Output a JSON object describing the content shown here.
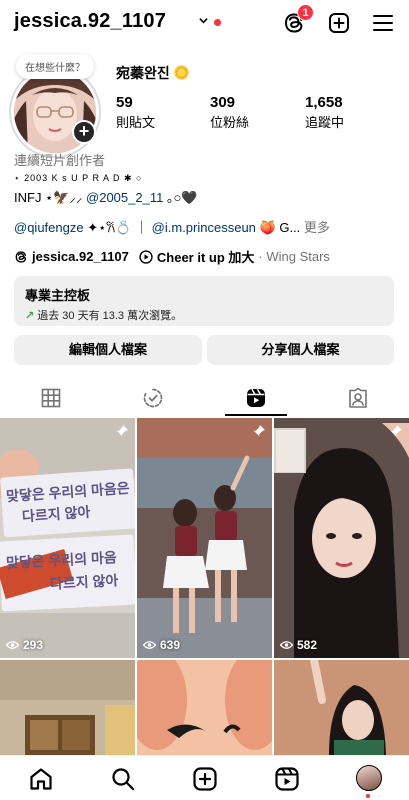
{
  "header": {
    "username": "jessica.92_1107",
    "notification_count": "1"
  },
  "profile": {
    "note": "在想些什麼？",
    "display_name": "宛蓁완진",
    "stats": [
      {
        "value": "59",
        "label": "則貼文"
      },
      {
        "value": "309",
        "label": "位粉絲"
      },
      {
        "value": "1,658",
        "label": "追蹤中"
      }
    ]
  },
  "bio": {
    "category": "連續短片創作者",
    "line1": "⋆ 2003 K s U P R A D ✱ ○",
    "line2_prefix": "INFJ ⋆🦅⸝⸝",
    "line2_handle": "@2005_2_11",
    "line2_suffix": "｡○🖤",
    "line3_handle1": "@qiufengze",
    "line3_mid": "✦⋆𐙚💍 ｜",
    "line3_handle2": "@i.m.princesseun",
    "line3_suffix": "🍑 G...",
    "more": "更多",
    "threads_handle": "jessica.92_1107",
    "song": "Cheer it up 加大",
    "artist": "· Wing Stars"
  },
  "dashboard": {
    "title": "專業主控板",
    "subtitle": "過去 30 天有 13.3 萬次瀏覽。",
    "arrow": "↗"
  },
  "buttons": {
    "edit": "編輯個人檔案",
    "share": "分享個人檔案"
  },
  "tabs": [
    "grid",
    "reels-circle",
    "reels",
    "tagged"
  ],
  "reels": [
    {
      "views": "293",
      "pinned": true,
      "overlay1": "맞닿은 우리의 마음은",
      "overlay2": "다르지 않아",
      "overlay3": "맞닿은 우리의 마음",
      "overlay4": "다르지 않아"
    },
    {
      "views": "639",
      "pinned": true
    },
    {
      "views": "582",
      "pinned": true
    }
  ],
  "colors": {
    "accent_red": "#ff3040",
    "link_blue": "#00376b",
    "button_gray": "#efefef",
    "muted_text": "#737373"
  }
}
